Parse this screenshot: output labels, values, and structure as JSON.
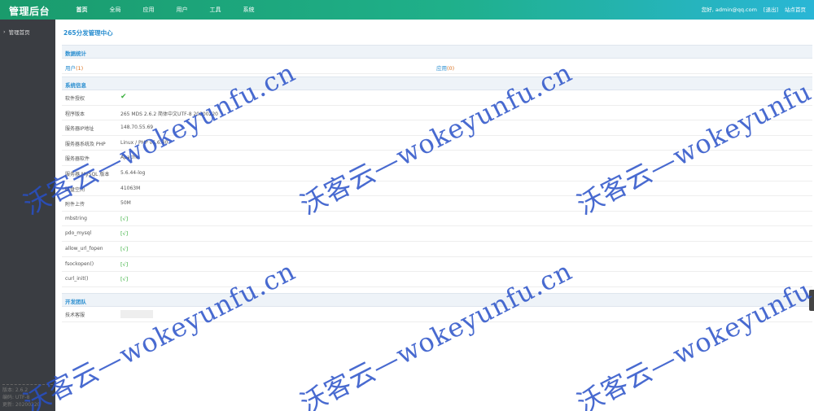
{
  "header": {
    "brand": "管理后台",
    "nav": [
      {
        "label": "首页"
      },
      {
        "label": "全局"
      },
      {
        "label": "应用"
      },
      {
        "label": "用户"
      },
      {
        "label": "工具"
      },
      {
        "label": "系统"
      }
    ],
    "greeting": "您好, admin@qq.com",
    "logout": "[退出]",
    "site_home": "站点首页"
  },
  "sidebar": {
    "items": [
      {
        "label": "管理首页"
      }
    ],
    "footer": [
      "版本: 2.6.2",
      "编码: UTF-8",
      "更新: 20200220"
    ]
  },
  "main": {
    "title": "265分发管理中心",
    "stats_section": "数据统计",
    "stats": [
      {
        "label": "用户",
        "count": "(1)"
      },
      {
        "label": "应用",
        "count": "(0)"
      }
    ],
    "sysinfo_section": "系统信息",
    "sysinfo": [
      {
        "label": "软件授权",
        "value": ""
      },
      {
        "label": "程序版本",
        "value": "265 MDS 2.6.2 简体中文UTF-8 20200220"
      },
      {
        "label": "服务器IP地址",
        "value": "148.70.55.69"
      },
      {
        "label": "服务器系统及 PHP",
        "value": "Linux / PHP v5.6.40"
      },
      {
        "label": "服务器软件",
        "value": "Apache"
      },
      {
        "label": "服务器 MySQL 版本",
        "value": "5.6.44-log"
      },
      {
        "label": "磁盘空间",
        "value": "41063M"
      },
      {
        "label": "附件上传",
        "value": "50M"
      },
      {
        "label": "mbstring",
        "value": "[√]"
      },
      {
        "label": "pdo_mysql",
        "value": "[√]"
      },
      {
        "label": "allow_url_fopen",
        "value": "[√]"
      },
      {
        "label": "fsockopen()",
        "value": "[√]"
      },
      {
        "label": "curl_init()",
        "value": "[√]"
      }
    ],
    "team_section": "开发团队",
    "team": [
      {
        "label": "技术客服"
      }
    ]
  },
  "watermark": "沃客云—wokeyunfu.cn",
  "icons": {
    "check": "check-icon",
    "chevron": "chevron-right-icon"
  },
  "colors": {
    "header_start": "#1a9b6c",
    "header_end": "#29b6d6",
    "sidebar": "#3a3d42",
    "accent": "#2a8ed0",
    "ok": "#3ab03e"
  }
}
